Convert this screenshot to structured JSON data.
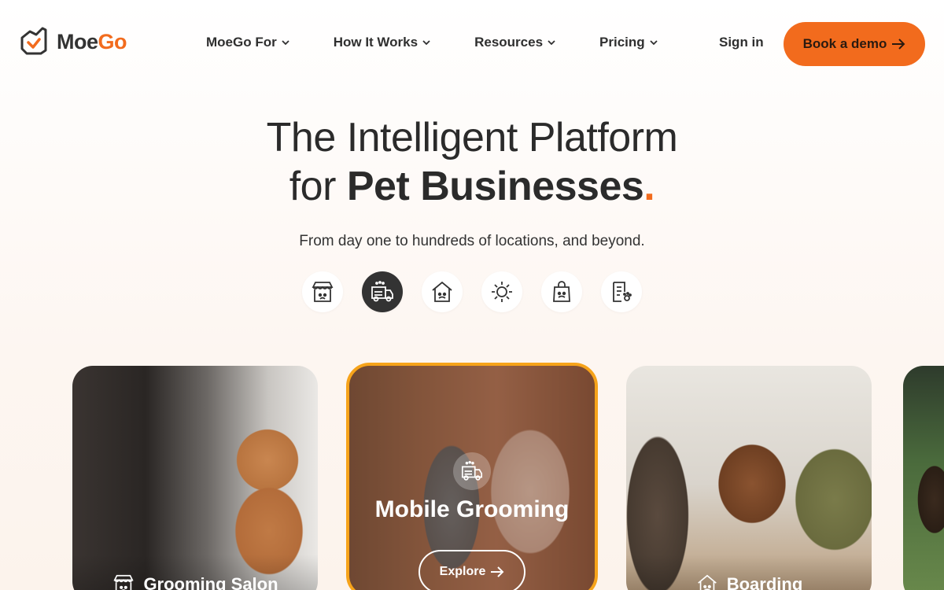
{
  "header": {
    "logo_text_moe": "Moe",
    "logo_text_go": "Go",
    "nav": [
      {
        "label": "MoeGo For"
      },
      {
        "label": "How It Works"
      },
      {
        "label": "Resources"
      },
      {
        "label": "Pricing"
      }
    ],
    "signin_label": "Sign in",
    "demo_label": "Book a demo",
    "accent_color": "#f26b1d"
  },
  "hero": {
    "title_line1": "The Intelligent Platform",
    "title_line2_prefix": "for",
    "title_line2_bold": "Pet Businesses",
    "title_dot": ".",
    "subtitle": "From day one to hundreds of locations, and beyond."
  },
  "categories": [
    {
      "icon": "storefront-icon",
      "active": false
    },
    {
      "icon": "mobile-van-icon",
      "active": true
    },
    {
      "icon": "boarding-house-icon",
      "active": false
    },
    {
      "icon": "daycare-sun-icon",
      "active": false
    },
    {
      "icon": "retail-bag-icon",
      "active": false
    },
    {
      "icon": "document-paw-icon",
      "active": false
    }
  ],
  "cards": {
    "salon_label": "Grooming Salon",
    "mobile_title": "Mobile Grooming",
    "mobile_button": "Explore",
    "boarding_label": "Boarding",
    "highlight_color": "#f6a31a"
  }
}
